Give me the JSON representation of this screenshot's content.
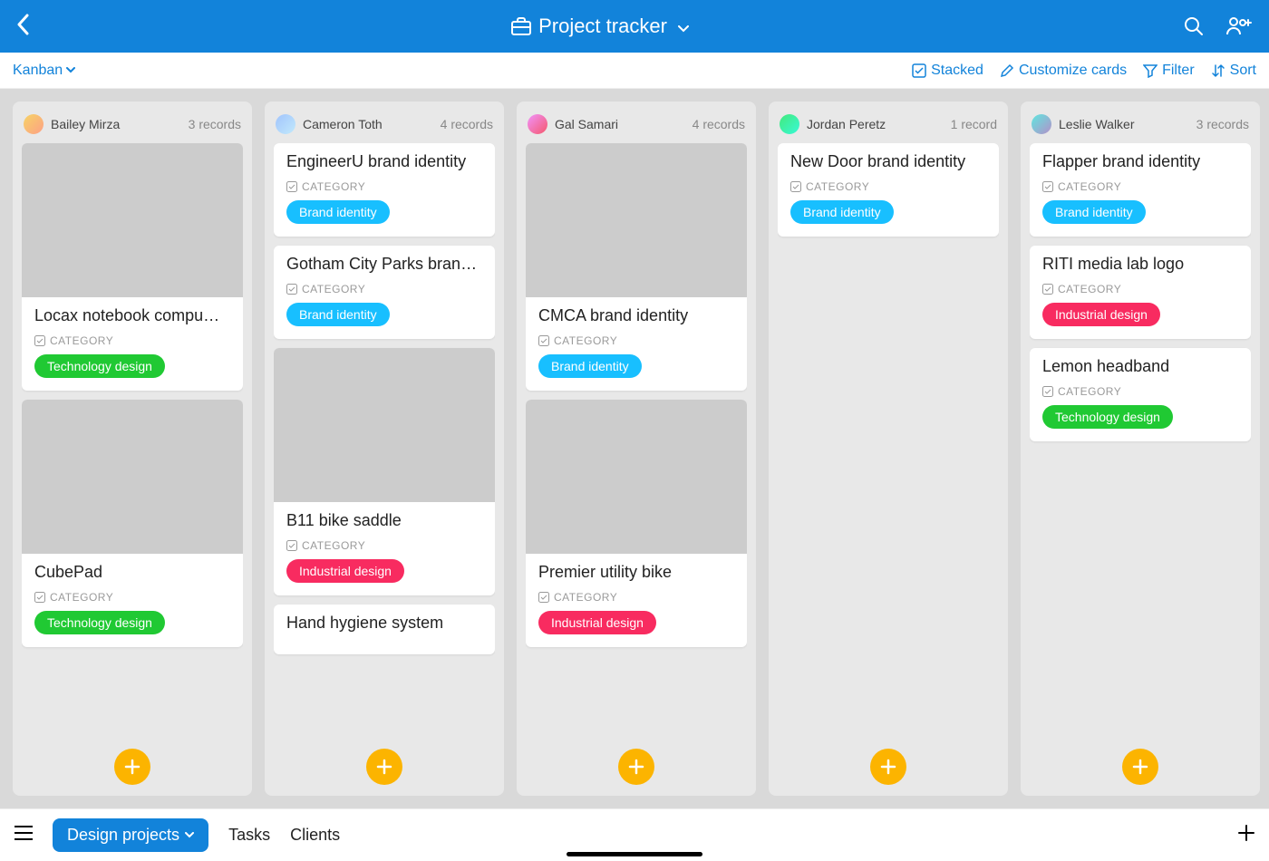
{
  "header": {
    "title": "Project tracker"
  },
  "toolbar": {
    "view": "Kanban",
    "stacked": "Stacked",
    "customize": "Customize cards",
    "filter": "Filter",
    "sort": "Sort"
  },
  "tag_label": "CATEGORY",
  "tags": {
    "brand": {
      "label": "Brand identity",
      "color": "#18bfff"
    },
    "tech": {
      "label": "Technology design",
      "color": "#20c933"
    },
    "industrial": {
      "label": "Industrial design",
      "color": "#f82b60"
    }
  },
  "columns": [
    {
      "name": "Bailey Mirza",
      "count": "3 records",
      "avatar": "av1",
      "cards": [
        {
          "title": "Locax notebook compu…",
          "thumb": "thumb1",
          "tag": "tech"
        },
        {
          "title": "CubePad",
          "thumb": "thumb2",
          "tag": "tech"
        }
      ]
    },
    {
      "name": "Cameron Toth",
      "count": "4 records",
      "avatar": "av2",
      "cards": [
        {
          "title": "EngineerU brand identity",
          "tag": "brand"
        },
        {
          "title": "Gotham City Parks bran…",
          "tag": "brand"
        },
        {
          "title": "B11 bike saddle",
          "thumb": "thumb3",
          "tag": "industrial"
        },
        {
          "title": "Hand hygiene system"
        }
      ]
    },
    {
      "name": "Gal Samari",
      "count": "4 records",
      "avatar": "av3",
      "cards": [
        {
          "title": "CMCA brand identity",
          "thumb": "thumb4",
          "tag": "brand"
        },
        {
          "title": "Premier utility bike",
          "thumb": "thumb5",
          "tag": "industrial"
        }
      ]
    },
    {
      "name": "Jordan Peretz",
      "count": "1 record",
      "avatar": "av4",
      "cards": [
        {
          "title": "New Door brand identity",
          "tag": "brand"
        }
      ]
    },
    {
      "name": "Leslie Walker",
      "count": "3 records",
      "avatar": "av5",
      "cards": [
        {
          "title": "Flapper brand identity",
          "tag": "brand"
        },
        {
          "title": "RITI media lab logo",
          "tag": "industrial"
        },
        {
          "title": "Lemon headband",
          "tag": "tech"
        }
      ]
    }
  ],
  "bottom": {
    "active": "Design projects",
    "tabs": [
      "Tasks",
      "Clients"
    ]
  }
}
